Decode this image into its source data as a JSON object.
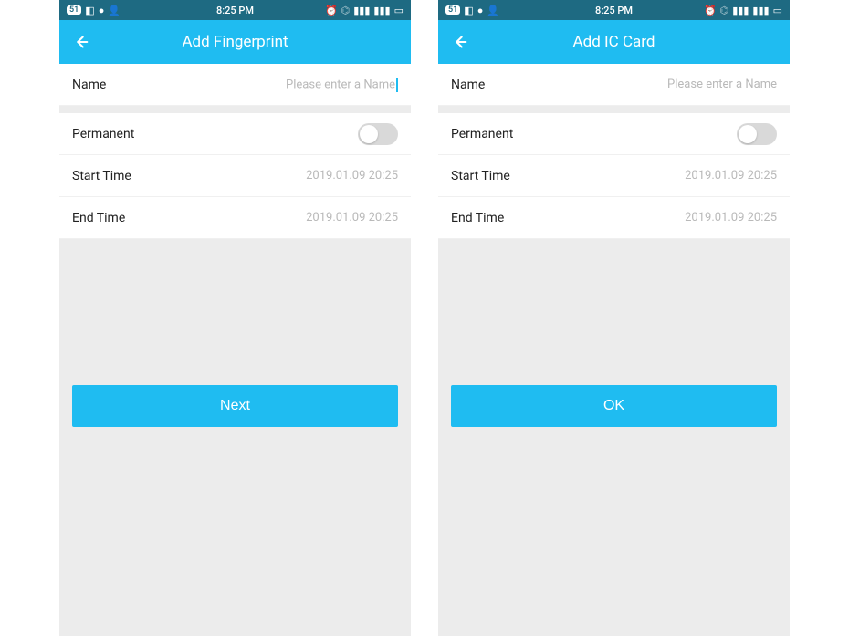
{
  "statusbar": {
    "badge": "51",
    "time": "8:25 PM"
  },
  "screens": [
    {
      "title": "Add Fingerprint",
      "nameLabel": "Name",
      "namePlaceholder": "Please enter a Name",
      "nameHasCursor": true,
      "permanentLabel": "Permanent",
      "startLabel": "Start Time",
      "startValue": "2019.01.09 20:25",
      "endLabel": "End Time",
      "endValue": "2019.01.09 20:25",
      "action": "Next"
    },
    {
      "title": "Add IC Card",
      "nameLabel": "Name",
      "namePlaceholder": "Please enter a Name",
      "nameHasCursor": false,
      "permanentLabel": "Permanent",
      "startLabel": "Start Time",
      "startValue": "2019.01.09 20:25",
      "endLabel": "End Time",
      "endValue": "2019.01.09 20:25",
      "action": "OK"
    }
  ]
}
